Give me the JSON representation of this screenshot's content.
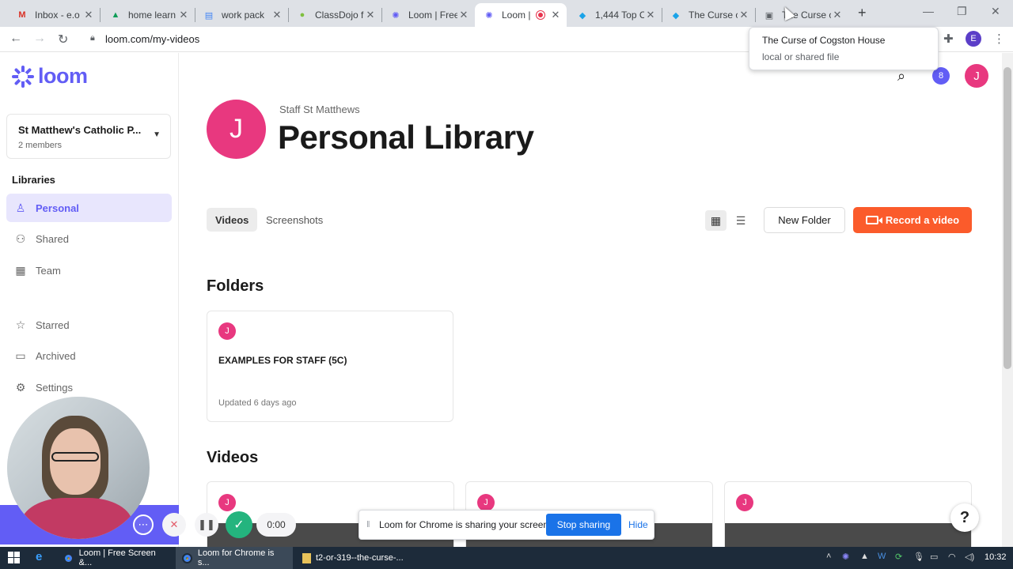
{
  "browser": {
    "tabs": [
      {
        "title": "Inbox - e.o",
        "icon": "gmail-icon",
        "glyph": "M",
        "color": "#d93025"
      },
      {
        "title": "home learn",
        "icon": "drive-icon",
        "glyph": "▲",
        "color": "#0f9d58"
      },
      {
        "title": "work pack",
        "icon": "docs-icon",
        "glyph": "▤",
        "color": "#4285f4"
      },
      {
        "title": "ClassDojo f",
        "icon": "classdojo-icon",
        "glyph": "●",
        "color": "#7fbf3f"
      },
      {
        "title": "Loom | Free",
        "icon": "loom-icon",
        "glyph": "✺",
        "color": "#625df5"
      },
      {
        "title": "Loom |",
        "icon": "loom-icon",
        "glyph": "✺",
        "color": "#625df5"
      },
      {
        "title": "1,444 Top C",
        "icon": "twinkl-icon",
        "glyph": "◆",
        "color": "#1aa3e8"
      },
      {
        "title": "The Curse c",
        "icon": "twinkl-icon",
        "glyph": "◆",
        "color": "#1aa3e8"
      },
      {
        "title": "The Curse c",
        "icon": "file-icon",
        "glyph": "▣",
        "color": "#5f6368"
      }
    ],
    "url": "loom.com/my-videos",
    "profile_initial": "E",
    "tooltip": {
      "title": "The Curse of Cogston House",
      "subtitle": "local or shared file"
    }
  },
  "sidebar": {
    "brand": "loom",
    "workspace": {
      "name": "St Matthew's Catholic P...",
      "members": "2 members"
    },
    "section_label": "Libraries",
    "items": [
      {
        "label": "Personal",
        "icon": "person-icon",
        "glyph": "♙"
      },
      {
        "label": "Shared",
        "icon": "people-icon",
        "glyph": "⚇"
      },
      {
        "label": "Team",
        "icon": "building-icon",
        "glyph": "▦"
      },
      {
        "label": "Starred",
        "icon": "star-icon",
        "glyph": "☆"
      },
      {
        "label": "Archived",
        "icon": "archive-icon",
        "glyph": "▭"
      },
      {
        "label": "Settings",
        "icon": "gear-icon",
        "glyph": "⚙"
      }
    ]
  },
  "recorder": {
    "timer": "0:00"
  },
  "header": {
    "avatar_b": "8",
    "avatar_j": "J"
  },
  "library": {
    "owner_initial": "J",
    "owner": "Staff St Matthews",
    "title": "Personal Library",
    "tabs": [
      "Videos",
      "Screenshots"
    ],
    "new_folder_label": "New Folder",
    "record_label": "Record a video"
  },
  "folders": {
    "heading": "Folders",
    "items": [
      {
        "initial": "J",
        "name": "EXAMPLES FOR STAFF (5C)",
        "updated": "Updated 6 days ago"
      }
    ]
  },
  "videos": {
    "heading": "Videos",
    "items": [
      {
        "initial": "J"
      },
      {
        "initial": "J"
      },
      {
        "initial": "J"
      }
    ]
  },
  "share_notice": {
    "message": "Loom for Chrome is sharing your screen.",
    "stop_label": "Stop sharing",
    "hide_label": "Hide"
  },
  "help_label": "?",
  "taskbar": {
    "apps": [
      {
        "title": "Loom | Free Screen &..."
      },
      {
        "title": "Loom for Chrome is s..."
      },
      {
        "title": "t2-or-319--the-curse-..."
      }
    ],
    "clock": "10:32"
  }
}
